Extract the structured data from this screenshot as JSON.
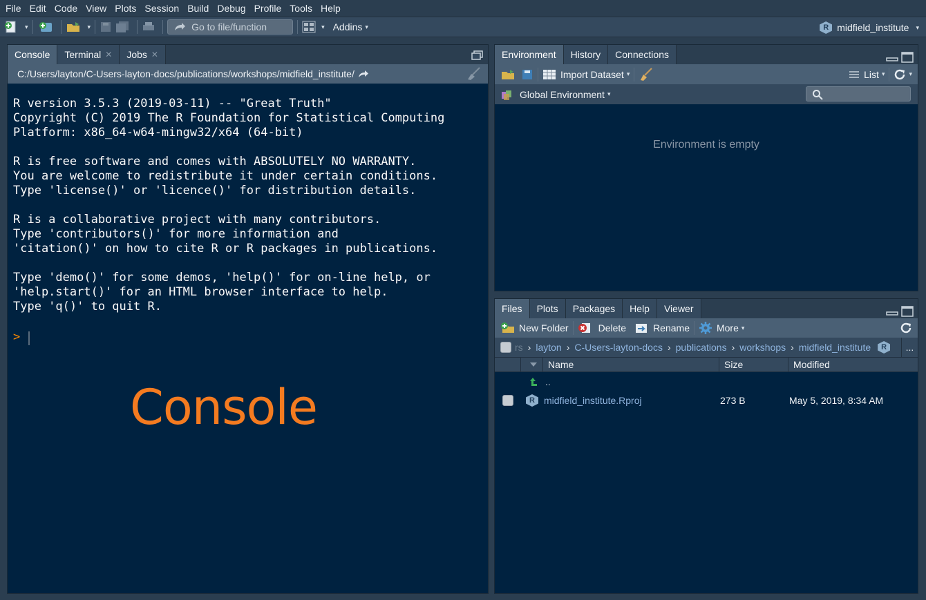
{
  "menu": [
    "File",
    "Edit",
    "Code",
    "View",
    "Plots",
    "Session",
    "Build",
    "Debug",
    "Profile",
    "Tools",
    "Help"
  ],
  "toolbar": {
    "goto_placeholder": "Go to file/function",
    "addins_label": "Addins",
    "project_label": "midfield_institute"
  },
  "console": {
    "tabs": [
      "Console",
      "Terminal",
      "Jobs"
    ],
    "path": "C:/Users/layton/C-Users-layton-docs/publications/workshops/midfield_institute/",
    "startup_text": "R version 3.5.3 (2019-03-11) -- \"Great Truth\"\nCopyright (C) 2019 The R Foundation for Statistical Computing\nPlatform: x86_64-w64-mingw32/x64 (64-bit)\n\nR is free software and comes with ABSOLUTELY NO WARRANTY.\nYou are welcome to redistribute it under certain conditions.\nType 'license()' or 'licence()' for distribution details.\n\nR is a collaborative project with many contributors.\nType 'contributors()' for more information and\n'citation()' on how to cite R or R packages in publications.\n\nType 'demo()' for some demos, 'help()' for on-line help, or\n'help.start()' for an HTML browser interface to help.\nType 'q()' to quit R.",
    "prompt": ">",
    "overlay_label": "Console"
  },
  "environment": {
    "tabs": [
      "Environment",
      "History",
      "Connections"
    ],
    "import_label": "Import Dataset",
    "list_label": "List",
    "scope_label": "Global Environment",
    "empty_message": "Environment is empty"
  },
  "files": {
    "tabs": [
      "Files",
      "Plots",
      "Packages",
      "Help",
      "Viewer"
    ],
    "actions": {
      "new_folder": "New Folder",
      "delete": "Delete",
      "rename": "Rename",
      "more": "More"
    },
    "breadcrumb": [
      "layton",
      "C-Users-layton-docs",
      "publications",
      "workshops",
      "midfield_institute"
    ],
    "breadcrumb_home": "rs",
    "columns": {
      "name": "Name",
      "size": "Size",
      "modified": "Modified"
    },
    "parent_label": "..",
    "rows": [
      {
        "name": "midfield_institute.Rproj",
        "size": "273 B",
        "modified": "May 5, 2019, 8:34 AM"
      }
    ],
    "ellipsis": "..."
  },
  "colors": {
    "accent_orange": "#f47b20",
    "pane_bg": "#002240",
    "chrome": "#34495e"
  }
}
